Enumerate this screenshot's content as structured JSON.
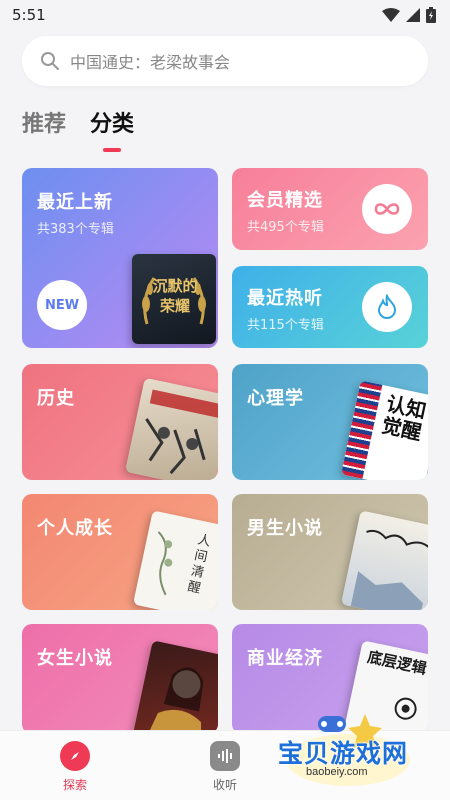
{
  "status": {
    "time": "5:51"
  },
  "search": {
    "placeholder": "中国通史：老梁故事会"
  },
  "tabs": [
    {
      "label": "推荐",
      "active": false
    },
    {
      "label": "分类",
      "active": true
    }
  ],
  "cards": {
    "recent_new": {
      "title": "最近上新",
      "subtitle": "共383个专辑",
      "badge": "NEW",
      "cover_text": "沉默的荣耀"
    },
    "vip": {
      "title": "会员精选",
      "subtitle": "共495个专辑"
    },
    "hot": {
      "title": "最近热听",
      "subtitle": "共115个专辑"
    },
    "history": {
      "title": "历史"
    },
    "psychology": {
      "title": "心理学",
      "cover_text": "认知觉醒"
    },
    "growth": {
      "title": "个人成长",
      "cover_text": "人间清醒"
    },
    "male_novel": {
      "title": "男生小说"
    },
    "female_novel": {
      "title": "女生小说"
    },
    "business": {
      "title": "商业经济",
      "cover_text": "底层逻辑"
    }
  },
  "bottom_nav": [
    {
      "label": "探索",
      "active": true
    },
    {
      "label": "收听",
      "active": false
    }
  ],
  "watermark": {
    "text": "宝贝游戏网",
    "url": "baobeiy.com"
  },
  "colors": {
    "accent": "#ee3a55"
  }
}
